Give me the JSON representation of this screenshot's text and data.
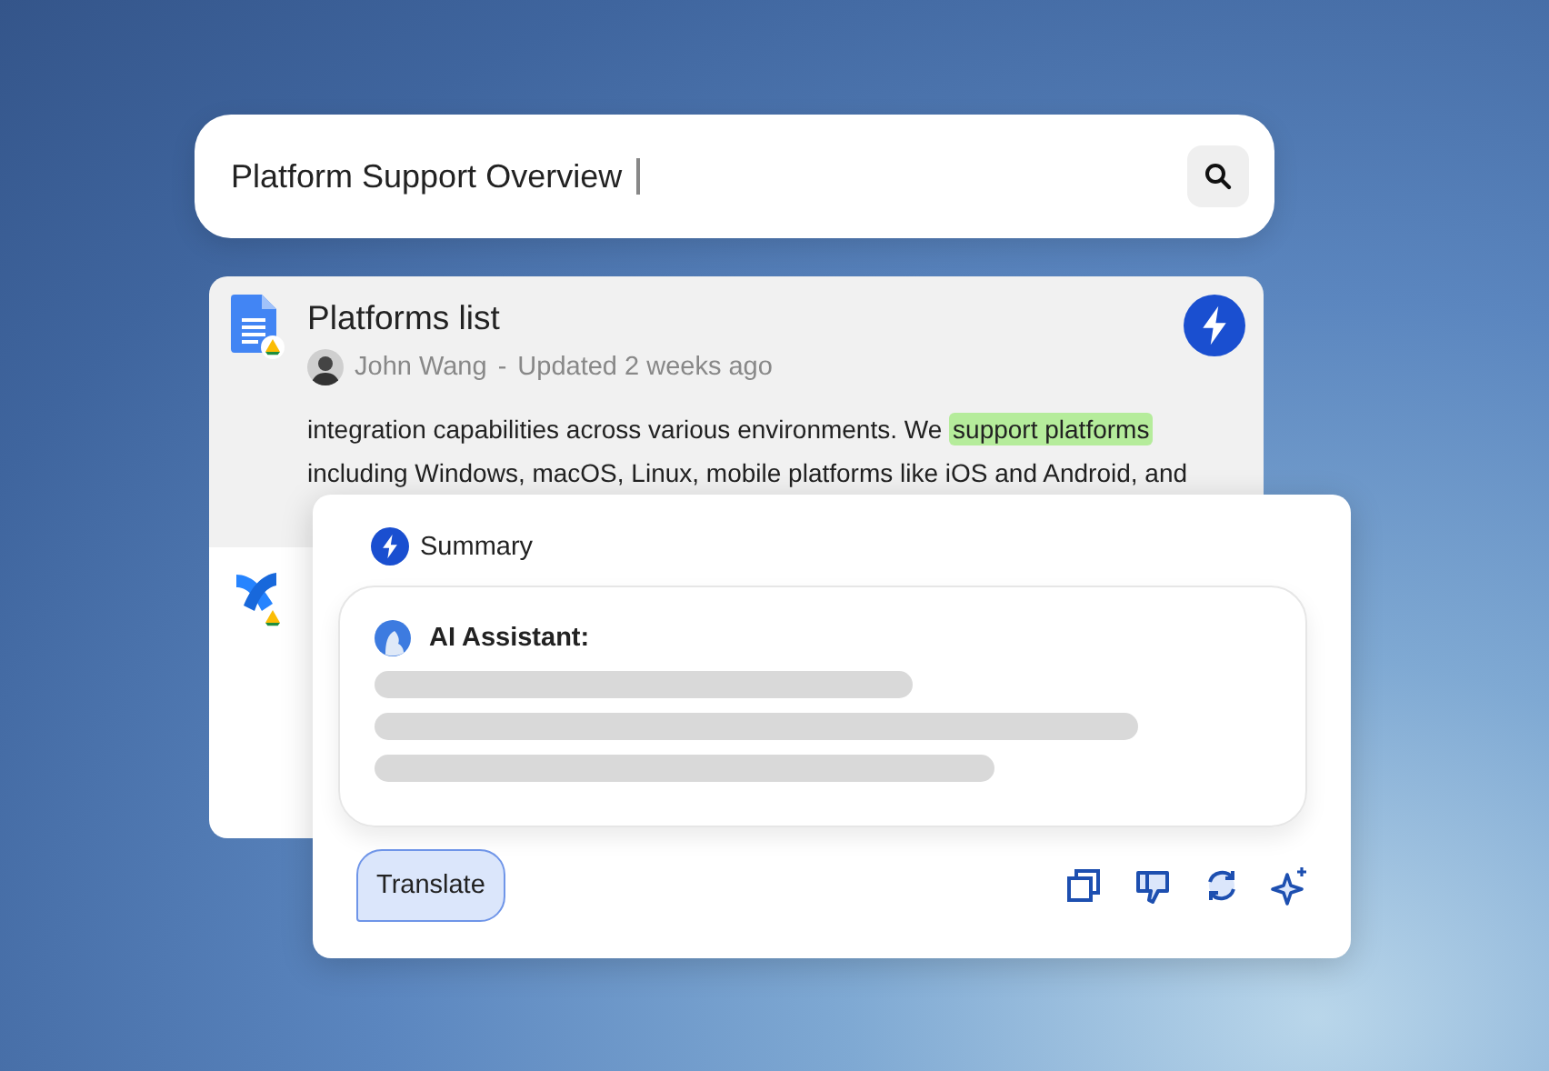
{
  "search": {
    "value": "Platform Support Overview",
    "focused": true
  },
  "results": [
    {
      "kind": "document",
      "selected": true,
      "summarized": true,
      "title": "Platforms list",
      "author": "John Wang",
      "separator": "-",
      "updated": "Updated 2 weeks ago",
      "snippet_lines": [
        [
          {
            "text": "integration capabilities across various environments. We ",
            "highlight": false
          },
          {
            "text": "support platforms",
            "highlight": true
          }
        ],
        [
          {
            "text": "including Windows, macOS, Linux, mobile platforms like iOS and Android, and",
            "highlight": false
          }
        ]
      ]
    },
    {
      "kind": "cross",
      "selected": false,
      "summarized": false
    }
  ],
  "summary": {
    "title": "Summary",
    "assistant_label": "AI Assistant:",
    "loading": true,
    "translate_button": "Translate"
  }
}
